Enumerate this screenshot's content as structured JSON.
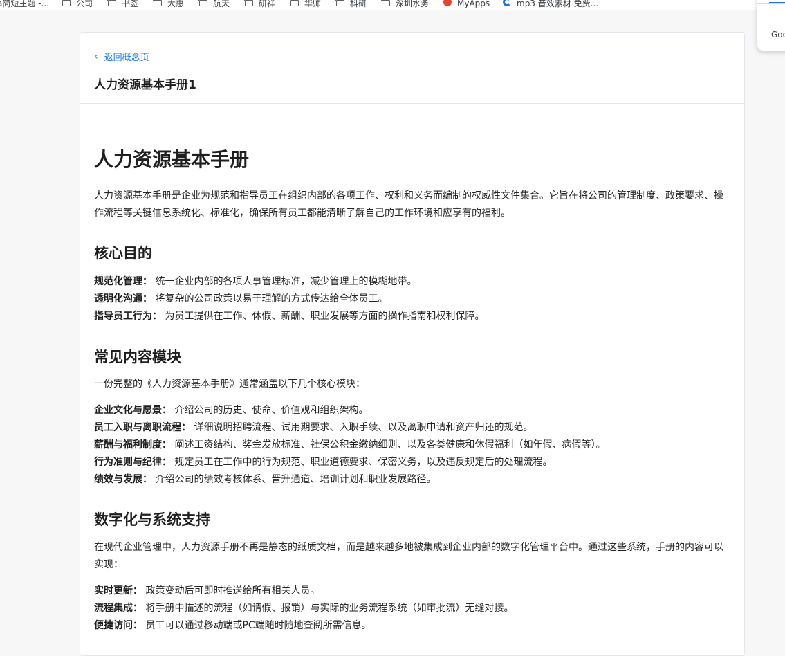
{
  "bookmarks": [
    {
      "label": "a简短主题 -...",
      "icon": "none"
    },
    {
      "label": "公司",
      "icon": "folder-icon"
    },
    {
      "label": "书签",
      "icon": "folder-icon"
    },
    {
      "label": "大惠",
      "icon": "folder-icon"
    },
    {
      "label": "航天",
      "icon": "folder-icon"
    },
    {
      "label": "研祥",
      "icon": "folder-icon"
    },
    {
      "label": "华师",
      "icon": "folder-icon"
    },
    {
      "label": "科研",
      "icon": "folder-icon"
    },
    {
      "label": "深圳水务",
      "icon": "folder-icon"
    },
    {
      "label": "MyApps",
      "icon": "myapps-icon"
    },
    {
      "label": "mp3 音效素材 免费...",
      "icon": "mp3-site-icon"
    }
  ],
  "side_popup": {
    "label": "Goo"
  },
  "header": {
    "back_label": "返回概念页",
    "doc_title": "人力资源基本手册1"
  },
  "article": {
    "title": "人力资源基本手册",
    "intro": "人力资源基本手册是企业为规范和指导员工在组织内部的各项工作、权利和义务而编制的权威性文件集合。它旨在将公司的管理制度、政策要求、操作流程等关键信息系统化、标准化，确保所有员工都能清晰了解自己的工作环境和应享有的福利。",
    "sections": [
      {
        "heading": "核心目的",
        "intro": "",
        "items": [
          {
            "term": "规范化管理：",
            "desc": "统一企业内部的各项人事管理标准，减少管理上的模糊地带。"
          },
          {
            "term": "透明化沟通：",
            "desc": "将复杂的公司政策以易于理解的方式传达给全体员工。"
          },
          {
            "term": "指导员工行为：",
            "desc": "为员工提供在工作、休假、薪酬、职业发展等方面的操作指南和权利保障。"
          }
        ]
      },
      {
        "heading": "常见内容模块",
        "intro": "一份完整的《人力资源基本手册》通常涵盖以下几个核心模块：",
        "items": [
          {
            "term": "企业文化与愿景：",
            "desc": "介绍公司的历史、使命、价值观和组织架构。"
          },
          {
            "term": "员工入职与离职流程：",
            "desc": "详细说明招聘流程、试用期要求、入职手续、以及离职申请和资产归还的规范。"
          },
          {
            "term": "薪酬与福利制度：",
            "desc": "阐述工资结构、奖金发放标准、社保公积金缴纳细则、以及各类健康和休假福利（如年假、病假等）。"
          },
          {
            "term": "行为准则与纪律：",
            "desc": "规定员工在工作中的行为规范、职业道德要求、保密义务，以及违反规定后的处理流程。"
          },
          {
            "term": "绩效与发展：",
            "desc": "介绍公司的绩效考核体系、晋升通道、培训计划和职业发展路径。"
          }
        ]
      },
      {
        "heading": "数字化与系统支持",
        "intro": "在现代企业管理中，人力资源手册不再是静态的纸质文档，而是越来越多地被集成到企业内部的数字化管理平台中。通过这些系统，手册的内容可以实现：",
        "items": [
          {
            "term": "实时更新：",
            "desc": "政策变动后可即时推送给所有相关人员。"
          },
          {
            "term": "流程集成：",
            "desc": "将手册中描述的流程（如请假、报销）与实际的业务流程系统（如审批流）无缝对接。"
          },
          {
            "term": "便捷访问：",
            "desc": "员工可以通过移动端或PC端随时随地查阅所需信息。"
          }
        ]
      }
    ]
  },
  "colors": {
    "link": "#1677ff",
    "card_border": "#e5e6eb",
    "background": "#f7f7f8"
  }
}
